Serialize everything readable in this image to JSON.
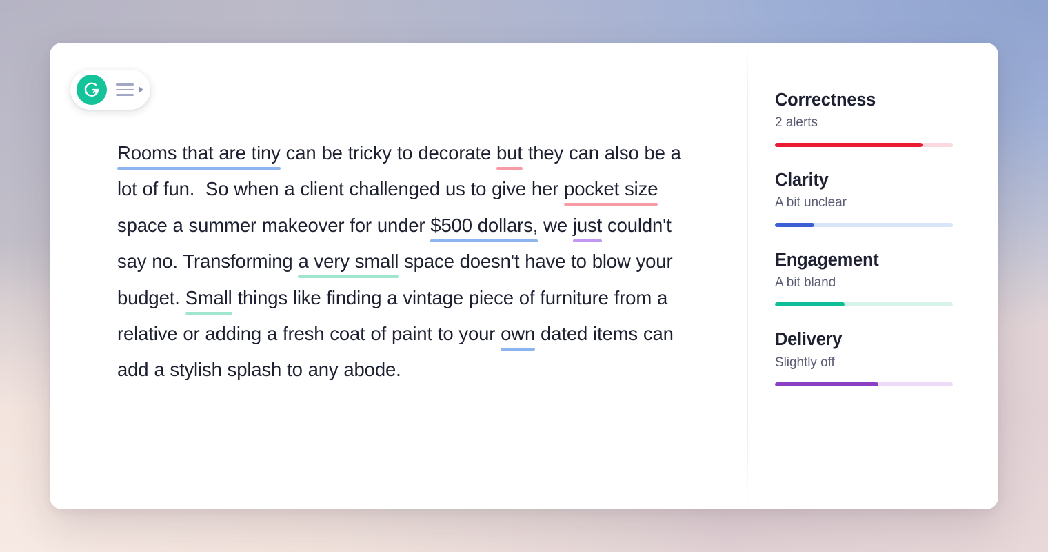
{
  "background": {
    "top_left": "#b5b4c4",
    "top_right": "#8fa3cf",
    "bottom_left": "#f7e9e3",
    "bottom_right": "#e8d8d9"
  },
  "toolbar": {
    "logo_label": "Grammarly",
    "logo_color": "#15c39a",
    "menu_label": "Menu",
    "expand_label": "Expand"
  },
  "document": {
    "segments": [
      {
        "text": "Rooms that are tiny",
        "mark": "blue"
      },
      {
        "text": " can be tricky to decorate ",
        "mark": null
      },
      {
        "text": "but",
        "mark": "red"
      },
      {
        "text": " they can also be a lot of fun.  So when a client challenged us to give her ",
        "mark": null
      },
      {
        "text": "pocket size",
        "mark": "red"
      },
      {
        "text": " space a summer makeover for under ",
        "mark": null
      },
      {
        "text": "$500 dollars,",
        "mark": "blue"
      },
      {
        "text": " we ",
        "mark": null
      },
      {
        "text": "just",
        "mark": "purple"
      },
      {
        "text": " couldn't say no. Transforming ",
        "mark": null
      },
      {
        "text": "a very small",
        "mark": "green"
      },
      {
        "text": " space doesn't have to blow your budget. ",
        "mark": null
      },
      {
        "text": "Small",
        "mark": "green"
      },
      {
        "text": " things like finding a vintage piece of furniture from a relative or adding a fresh coat of paint to your ",
        "mark": null
      },
      {
        "text": "own",
        "mark": "blue"
      },
      {
        "text": " dated items can add a stylish splash to any abode.",
        "mark": null
      }
    ],
    "underline_colors": {
      "blue": "#8cb4ef",
      "red": "#f79ba6",
      "purple": "#c297f2",
      "green": "#9fe6cd"
    }
  },
  "sidebar": {
    "cards": [
      {
        "title": "Correctness",
        "status": "2 alerts",
        "percent": 83,
        "fill_color": "#ec1b34",
        "track_color": "#fbd9de"
      },
      {
        "title": "Clarity",
        "status": "A bit unclear",
        "percent": 22,
        "fill_color": "#3b5fd4",
        "track_color": "#d8e4f8"
      },
      {
        "title": "Engagement",
        "status": "A bit bland",
        "percent": 39,
        "fill_color": "#0fbd97",
        "track_color": "#d6f2ea"
      },
      {
        "title": "Delivery",
        "status": "Slightly off",
        "percent": 58,
        "fill_color": "#8b3fc4",
        "track_color": "#eddcf7"
      }
    ]
  }
}
